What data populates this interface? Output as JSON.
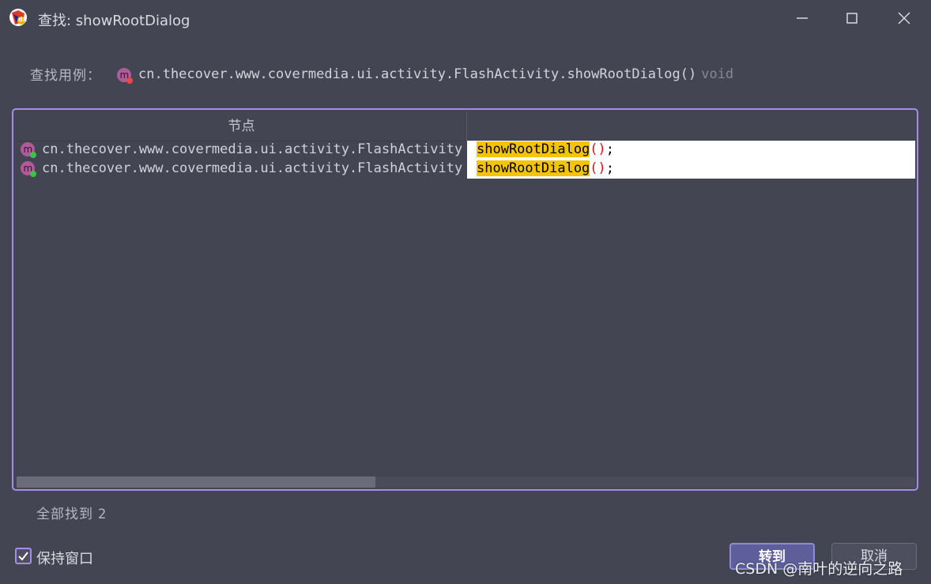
{
  "window": {
    "title": "查找: showRootDialog"
  },
  "search": {
    "label": "查找用例：",
    "method_signature": "cn.thecover.www.covermedia.ui.activity.FlashActivity.showRootDialog()",
    "return_type": "void"
  },
  "results": {
    "column_headers": [
      "节点",
      ""
    ],
    "rows": [
      {
        "node": "cn.thecover.www.covermedia.ui.activity.FlashActivity",
        "code_match": "showRootDialog",
        "code_parens": "()",
        "code_semicolon": ";"
      },
      {
        "node": "cn.thecover.www.covermedia.ui.activity.FlashActivity",
        "code_match": "showRootDialog",
        "code_parens": "()",
        "code_semicolon": ";"
      }
    ]
  },
  "status": {
    "found_label": "全部找到",
    "found_count": "2"
  },
  "footer": {
    "keep_window_label": "保持窗口",
    "keep_window_checked": true,
    "goto_label": "转到",
    "cancel_label": "取消"
  },
  "watermark": "CSDN @南叶的逆向之路",
  "colors": {
    "background": "#434552",
    "accent": "#a68ee8",
    "highlight": "#f5c400",
    "method_icon": "#b05a9a"
  },
  "icons": {
    "app": "jadx-icon",
    "method_top": "method-private-icon",
    "method_row": "method-public-icon"
  }
}
